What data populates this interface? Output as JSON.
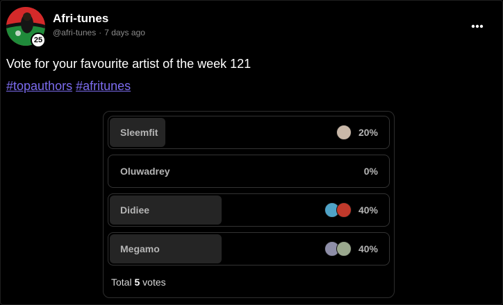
{
  "post": {
    "author": "Afri-tunes",
    "handle": "@afri-tunes",
    "separator": "·",
    "time": "7 days ago",
    "reputation": "25",
    "text": "Vote for your favourite artist of the week 121",
    "tags": [
      "#topauthors",
      "#afritunes"
    ]
  },
  "poll": {
    "options": [
      {
        "label": "Sleemfit",
        "percent": "20%",
        "fraction": 0.2,
        "voters": [
          "#c9b8a8"
        ]
      },
      {
        "label": "Oluwadrey",
        "percent": "0%",
        "fraction": 0.0,
        "voters": []
      },
      {
        "label": "Didiee",
        "percent": "40%",
        "fraction": 0.4,
        "voters": [
          "#4fa3c7",
          "#c0392b"
        ]
      },
      {
        "label": "Megamo",
        "percent": "40%",
        "fraction": 0.4,
        "voters": [
          "#8e8ea8",
          "#9aa88e"
        ]
      }
    ],
    "total_prefix": "Total",
    "total_count": "5",
    "total_suffix": "votes"
  },
  "colors": {
    "background": "#000000",
    "tag": "#7c6cf0",
    "option_fill": "#252525",
    "option_border": "#333333"
  },
  "icons": {
    "more": "more-horizontal-icon"
  }
}
